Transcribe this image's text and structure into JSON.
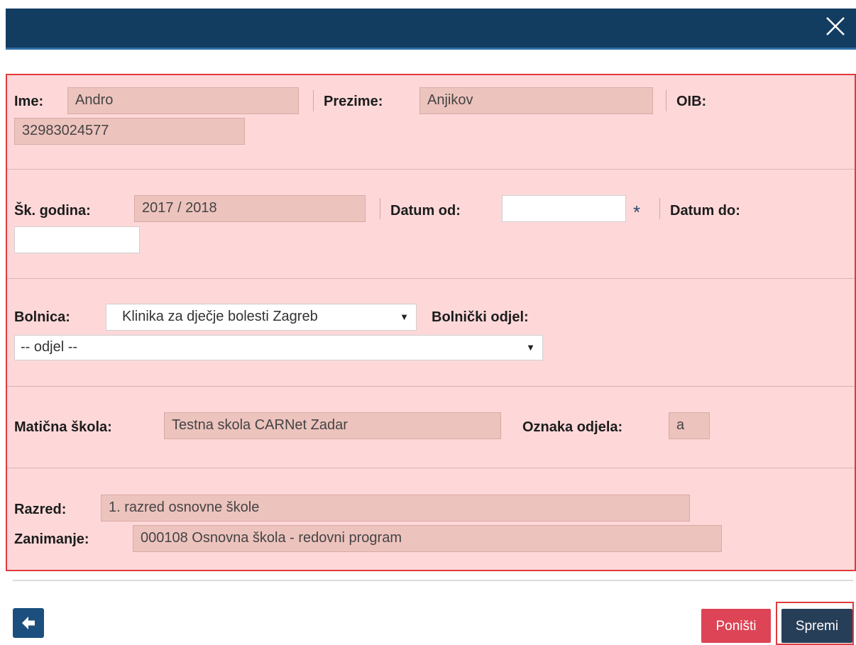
{
  "header": {
    "close_icon": "close-icon",
    "bar_color": "#133c61"
  },
  "student": {
    "ime_label": "Ime:",
    "ime_value": "Andro",
    "prezime_label": "Prezime:",
    "prezime_value": "Anjikov",
    "oib_label": "OIB:",
    "oib_value": "32983024577"
  },
  "period": {
    "godina_label": "Šk. godina:",
    "godina_value": "2017 / 2018",
    "datum_od_label": "Datum od:",
    "datum_od_value": "",
    "required_mark": "*",
    "datum_do_label": "Datum do:",
    "datum_do_value": ""
  },
  "hospital": {
    "bolnica_label": "Bolnica:",
    "bolnica_value": "Klinika za dječje bolesti Zagreb",
    "odjel_label": "Bolnički odjel:",
    "odjel_value": "-- odjel --"
  },
  "school": {
    "maticna_label": "Matična škola:",
    "maticna_value": "Testna skola CARNet Zadar",
    "oznaka_label": "Oznaka odjela:",
    "oznaka_value": "a"
  },
  "class_info": {
    "razred_label": "Razred:",
    "razred_value": "1. razred osnovne škole",
    "zanimanje_label": "Zanimanje:",
    "zanimanje_value": "000108 Osnovna škola - redovni program"
  },
  "footer": {
    "back_icon": "arrow-left-icon",
    "cancel_label": "Poništi",
    "save_label": "Spremi",
    "cancel_color": "#dd4456",
    "save_color": "#273e58"
  }
}
